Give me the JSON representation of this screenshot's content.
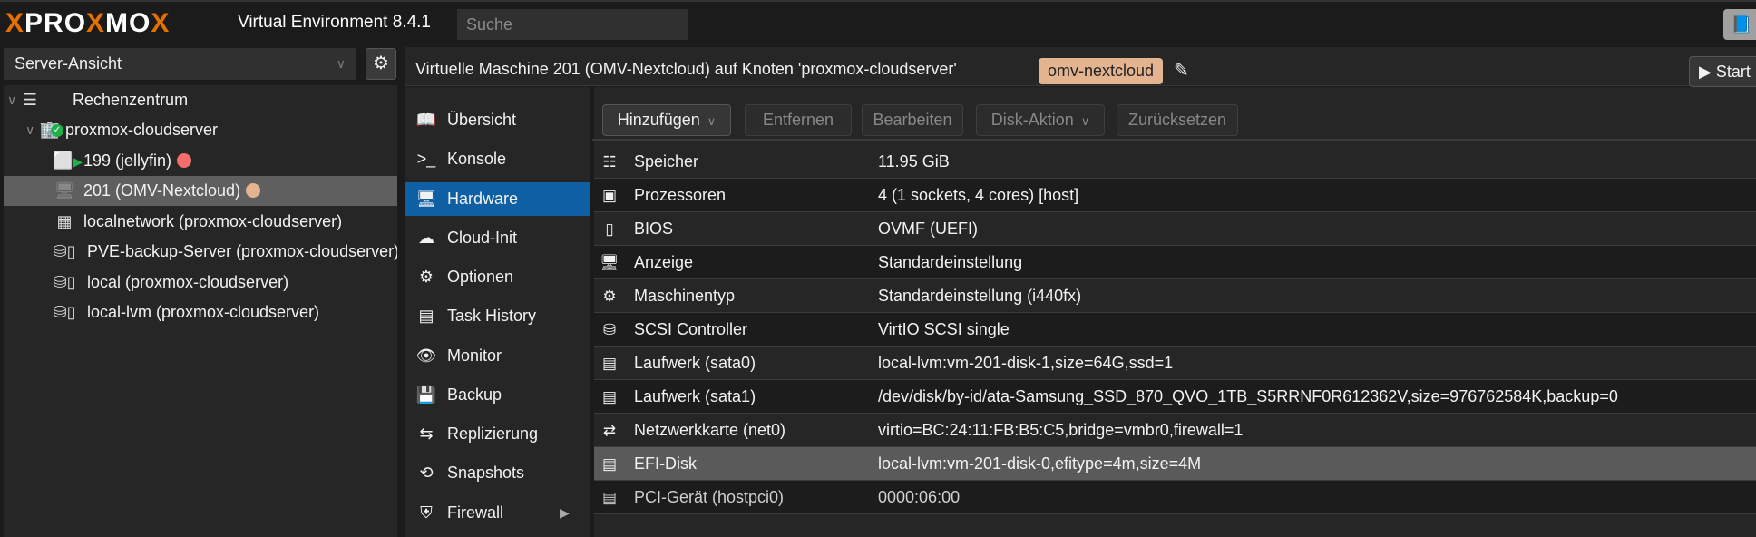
{
  "header": {
    "logo": "PROXMOX",
    "version": "Virtual Environment 8.4.1",
    "search_placeholder": "Suche"
  },
  "sidebar": {
    "view": "Server-Ansicht",
    "tree": [
      {
        "label": "Rechenzentrum",
        "icon": "server-rack-icon"
      },
      {
        "label": "proxmox-cloudserver",
        "icon": "node-online-icon"
      },
      {
        "label": "199 (jellyfin)",
        "icon": "vm-running-icon",
        "tag_color": "#f46d6d"
      },
      {
        "label": "201 (OMV-Nextcloud)",
        "icon": "vm-monitor-icon",
        "tag_color": "#e3b48f",
        "selected": true
      },
      {
        "label": "localnetwork (proxmox-cloudserver)",
        "icon": "network-grid-icon"
      },
      {
        "label": "PVE-backup-Server (proxmox-cloudserver)",
        "icon": "storage-icon"
      },
      {
        "label": "local (proxmox-cloudserver)",
        "icon": "storage-icon"
      },
      {
        "label": "local-lvm (proxmox-cloudserver)",
        "icon": "storage-icon"
      }
    ]
  },
  "titlebar": {
    "title": "Virtuelle Maschine 201 (OMV-Nextcloud) auf Knoten 'proxmox-cloudserver'",
    "tag": "omv-nextcloud",
    "start": "Start"
  },
  "nav": [
    {
      "label": "Übersicht",
      "icon": "book-icon"
    },
    {
      "label": "Konsole",
      "icon": "terminal-icon"
    },
    {
      "label": "Hardware",
      "icon": "monitor-icon",
      "selected": true
    },
    {
      "label": "Cloud-Init",
      "icon": "cloud-icon"
    },
    {
      "label": "Optionen",
      "icon": "gear-icon"
    },
    {
      "label": "Task History",
      "icon": "list-icon"
    },
    {
      "label": "Monitor",
      "icon": "eye-icon"
    },
    {
      "label": "Backup",
      "icon": "floppy-icon"
    },
    {
      "label": "Replizierung",
      "icon": "retweet-icon"
    },
    {
      "label": "Snapshots",
      "icon": "history-icon"
    },
    {
      "label": "Firewall",
      "icon": "shield-icon"
    }
  ],
  "toolbar": {
    "add": "Hinzufügen",
    "remove": "Entfernen",
    "edit": "Bearbeiten",
    "disk_action": "Disk-Aktion",
    "revert": "Zurücksetzen"
  },
  "hardware": [
    {
      "name": "Speicher",
      "value": "11.95 GiB",
      "icon": "memory-icon"
    },
    {
      "name": "Prozessoren",
      "value": "4 (1 sockets, 4 cores) [host]",
      "icon": "cpu-icon"
    },
    {
      "name": "BIOS",
      "value": "OVMF (UEFI)",
      "icon": "chip-icon"
    },
    {
      "name": "Anzeige",
      "value": "Standardeinstellung",
      "icon": "desktop-icon"
    },
    {
      "name": "Maschinentyp",
      "value": "Standardeinstellung (i440fx)",
      "icon": "cogs-icon"
    },
    {
      "name": "SCSI Controller",
      "value": "VirtIO SCSI single",
      "icon": "database-icon"
    },
    {
      "name": "Laufwerk (sata0)",
      "value": "local-lvm:vm-201-disk-1,size=64G,ssd=1",
      "icon": "hdd-icon"
    },
    {
      "name": "Laufwerk (sata1)",
      "value": "/dev/disk/by-id/ata-Samsung_SSD_870_QVO_1TB_S5RRNF0R612362V,size=976762584K,backup=0",
      "icon": "hdd-icon"
    },
    {
      "name": "Netzwerkkarte (net0)",
      "value": "virtio=BC:24:11:FB:B5:C5,bridge=vmbr0,firewall=1",
      "icon": "exchange-icon"
    },
    {
      "name": "EFI-Disk",
      "value": "local-lvm:vm-201-disk-0,efitype=4m,size=4M",
      "icon": "hdd-icon",
      "selected": true
    },
    {
      "name": "PCI-Gerät (hostpci0)",
      "value": "0000:06:00",
      "icon": "pci-card-icon",
      "pending": true
    }
  ]
}
